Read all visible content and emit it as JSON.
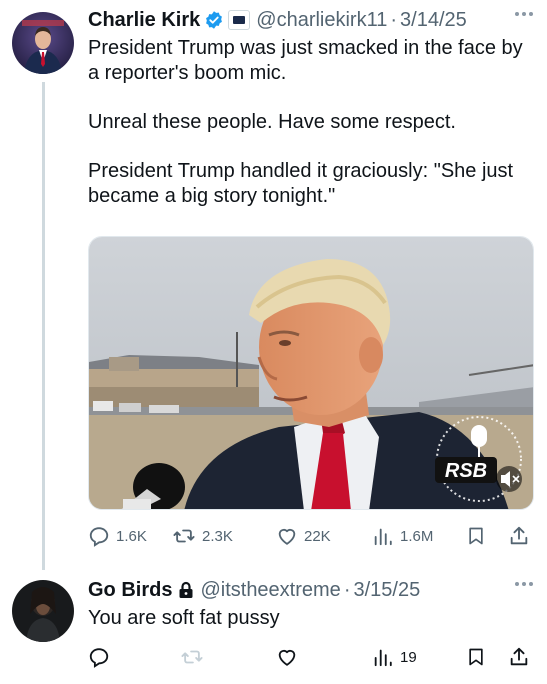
{
  "tweet1": {
    "display_name": "Charlie Kirk",
    "handle": "@charliekirk11",
    "date": "3/14/25",
    "lines": [
      "President Trump was just smacked in the face by a reporter's boom mic.",
      "Unreal these people. Have some respect.",
      "President Trump handled it graciously: \"She just became a big story tonight.\""
    ],
    "media_watermark": "RSB",
    "stats": {
      "replies": "1.6K",
      "reposts": "2.3K",
      "likes": "22K",
      "views": "1.6M"
    }
  },
  "tweet2": {
    "display_name": "Go Birds",
    "handle": "@itstheextreme",
    "date": "3/15/25",
    "text": "You are soft fat pussy",
    "stats": {
      "views": "19"
    }
  },
  "colors": {
    "text_primary": "#0f1419",
    "text_secondary": "#536471",
    "verified_blue": "#1d9bf0",
    "thread_line": "#cfd9de",
    "tie_red": "#c8102e"
  },
  "icons": [
    "verified-badge-icon",
    "affiliation-badge-icon",
    "lock-icon",
    "more-icon",
    "reply-icon",
    "repost-icon",
    "like-icon",
    "views-icon",
    "bookmark-icon",
    "share-icon",
    "mute-icon",
    "microphone-icon"
  ]
}
